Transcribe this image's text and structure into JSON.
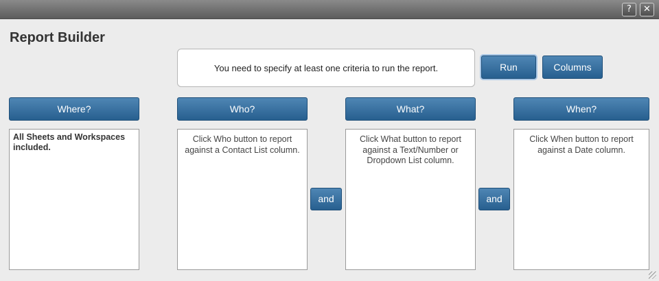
{
  "window": {
    "help_label": "?",
    "close_label": "✕",
    "icons": [
      "help-icon",
      "close-icon",
      "resize-grip-icon"
    ]
  },
  "dialog": {
    "title": "Report Builder",
    "message": "You need to specify at least one criteria to run the report.",
    "run_label": "Run",
    "columns_label": "Columns"
  },
  "criteria": {
    "where": {
      "label": "Where?",
      "text": "All Sheets and Workspaces included."
    },
    "who": {
      "label": "Who?",
      "text": "Click Who button to report against a Contact List column."
    },
    "what": {
      "label": "What?",
      "text": "Click What button to report against a Text/Number or Dropdown List column."
    },
    "when": {
      "label": "When?",
      "text": "Click When button to report against a Date column."
    },
    "and_label": "and"
  },
  "colors": {
    "button": "#2f6b9e",
    "titlebar": "#6e6e6e",
    "background": "#ececec"
  }
}
